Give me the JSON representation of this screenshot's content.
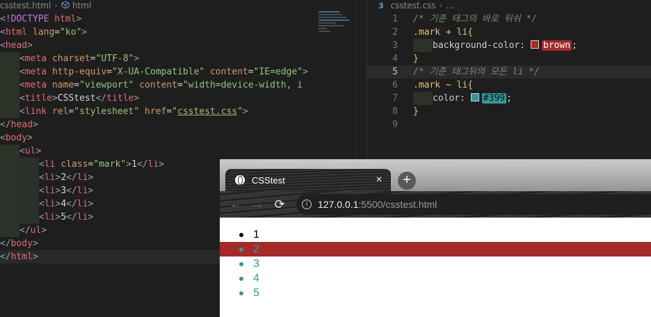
{
  "html_editor": {
    "breadcrumb": {
      "file": "csstest.html",
      "node": "html"
    },
    "lines": [
      "<!DOCTYPE html>",
      "<html lang=\"ko\">",
      "<head>",
      "<meta charset=\"UTF-8\">",
      "<meta http-equiv=\"X-UA-Compatible\" content=\"IE=edge\">",
      "<meta name=\"viewport\" content=\"width=device-width, i",
      "<title>CSStest</title>",
      "<link rel=\"stylesheet\" href=\"csstest.css\">",
      "</head>",
      "<body>",
      "<ul>",
      "<li class=\"mark\">1</li>",
      "<li>2</li>",
      "<li>3</li>",
      "<li>4</li>",
      "<li>5</li>",
      "</ul>",
      "</body>",
      "</html>"
    ]
  },
  "css_editor": {
    "breadcrumb": {
      "file": "csstest.css",
      "node": "..."
    },
    "line_numbers": [
      "1",
      "2",
      "3",
      "4",
      "5",
      "6",
      "7",
      "8",
      "9"
    ],
    "comment1": "/* 기준 태그의 바로 뒤쉬 */",
    "rule1_selector": ".mark + li{",
    "rule1_property": "background-color: ",
    "rule1_value": "brown",
    "comment2": "/* 기준 태그뒤의 모든 li */",
    "rule2_selector": ".mark ~ li{",
    "rule2_property": "color: ",
    "rule2_value": "#399",
    "close_brace": "}",
    "semicolon": ";",
    "colors": {
      "brown": "#a52a2a",
      "teal": "#339999"
    }
  },
  "browser": {
    "tab_title": "CSStest",
    "tab_close": "×",
    "new_tab": "+",
    "back": "←",
    "forward": "→",
    "reload": "⟳",
    "info": "i",
    "url_host": "127.0.0.1",
    "url_rest": ":5500/csstest.html",
    "list_items": [
      "1",
      "2",
      "3",
      "4",
      "5"
    ]
  }
}
